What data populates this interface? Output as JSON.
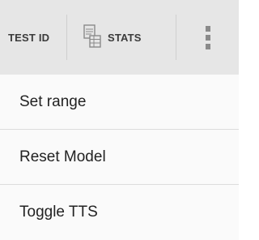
{
  "action_bar": {
    "test_id_label": "TEST ID",
    "stats_label": "STATS",
    "stats_icon": "stats-icon",
    "overflow_icon": "overflow-menu-icon"
  },
  "menu": {
    "items": [
      {
        "label": "Set range"
      },
      {
        "label": "Reset Model"
      },
      {
        "label": "Toggle TTS"
      }
    ]
  },
  "colors": {
    "action_bar_bg": "#e6e6e6",
    "menu_bg": "#fafafa",
    "text": "#222222"
  }
}
